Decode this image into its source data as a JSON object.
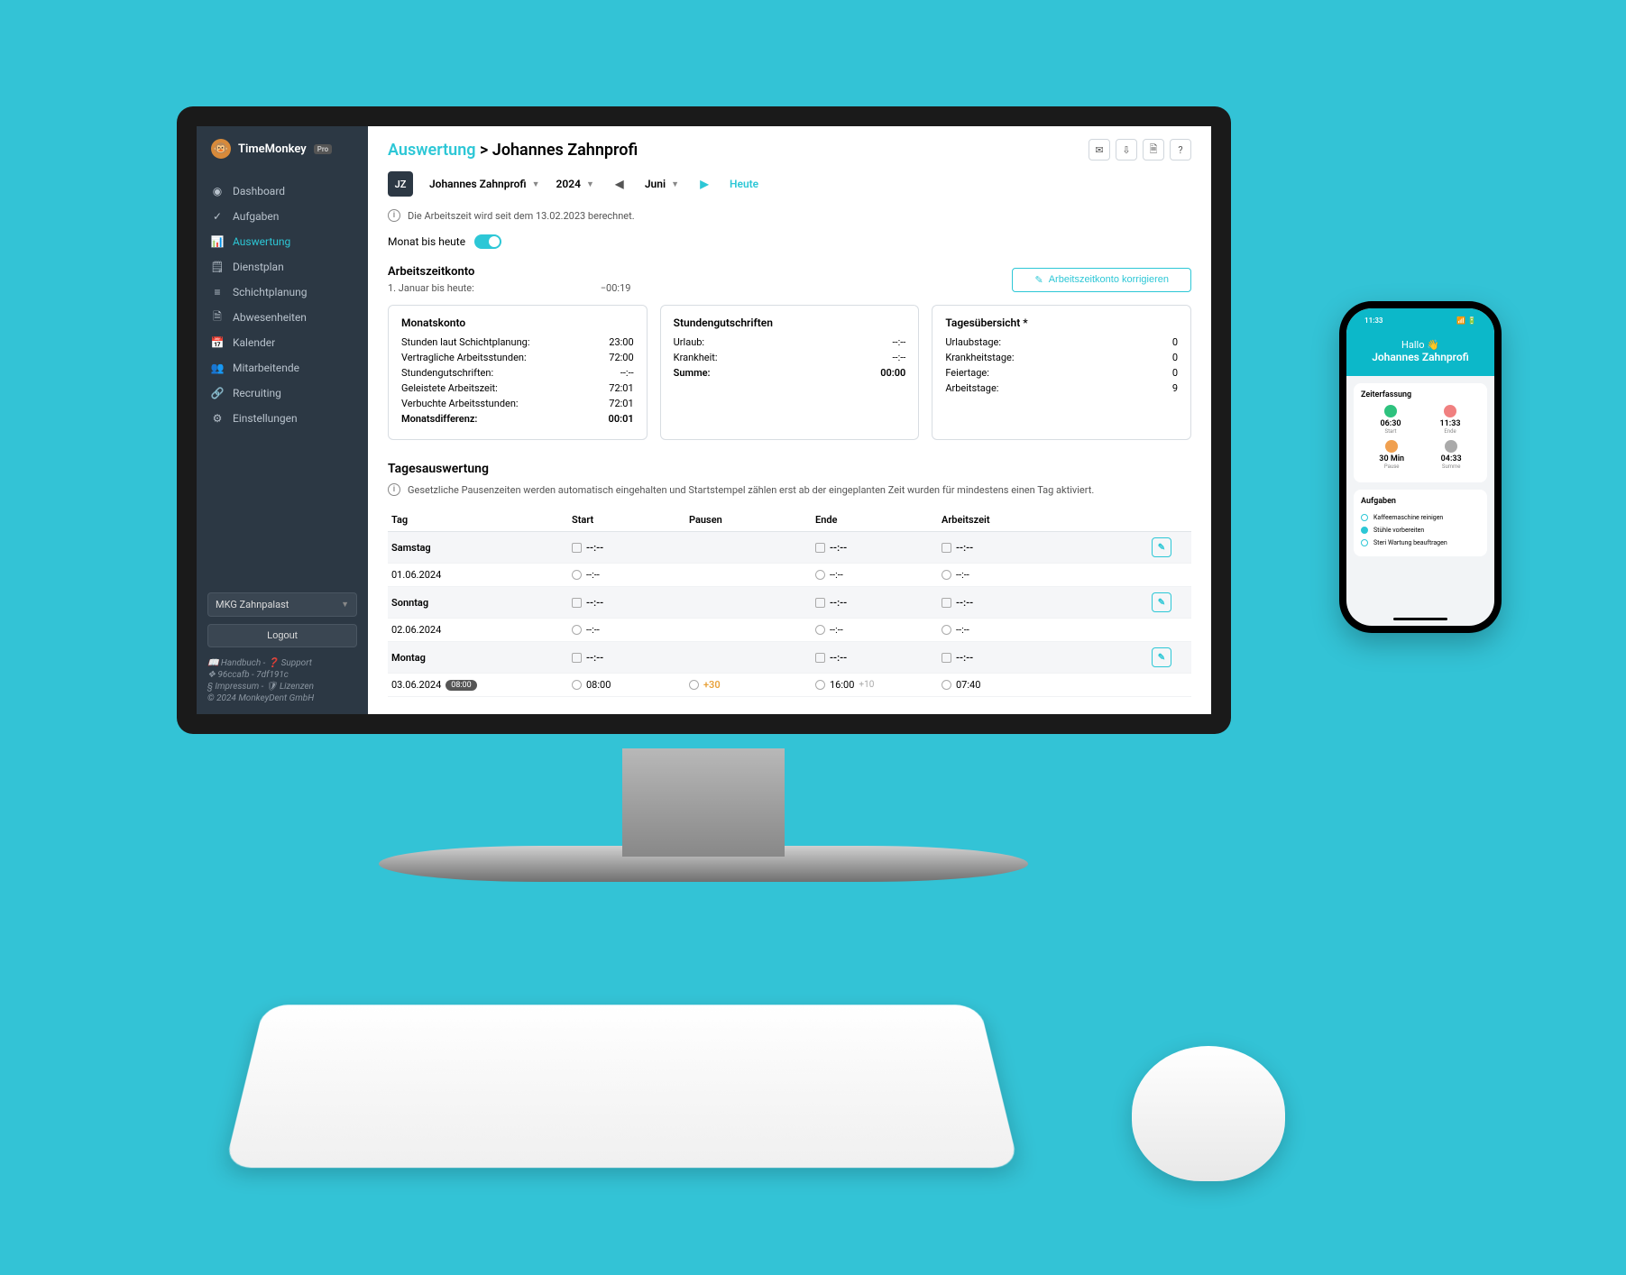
{
  "brand": {
    "name": "TimeMonkey",
    "badge": "Pro"
  },
  "sidebar": {
    "items": [
      {
        "label": "Dashboard",
        "icon": "gauge"
      },
      {
        "label": "Aufgaben",
        "icon": "check"
      },
      {
        "label": "Auswertung",
        "icon": "chart",
        "active": true
      },
      {
        "label": "Dienstplan",
        "icon": "clipboard"
      },
      {
        "label": "Schichtplanung",
        "icon": "layers"
      },
      {
        "label": "Abwesenheiten",
        "icon": "doc"
      },
      {
        "label": "Kalender",
        "icon": "calendar"
      },
      {
        "label": "Mitarbeitende",
        "icon": "people"
      },
      {
        "label": "Recruiting",
        "icon": "link"
      },
      {
        "label": "Einstellungen",
        "icon": "gear"
      }
    ],
    "org": "MKG Zahnpalast",
    "logout": "Logout",
    "footer": {
      "handbook": "Handbuch",
      "support": "Support",
      "build": "96ccafb - 7df191c",
      "impressum": "Impressum",
      "lizenzen": "Lizenzen",
      "copyright": "© 2024 MonkeyDent GmbH"
    }
  },
  "header": {
    "crumb_root": "Auswertung",
    "crumb_sep": ">",
    "crumb_leaf": "Johannes Zahnprofi"
  },
  "selector": {
    "avatar": "JZ",
    "name": "Johannes Zahnprofi",
    "year": "2024",
    "month": "Juni",
    "today": "Heute"
  },
  "info": "Die Arbeitszeit wird seit dem 13.02.2023 berechnet.",
  "toggle": {
    "label": "Monat bis heute",
    "on": true
  },
  "account": {
    "title": "Arbeitszeitkonto",
    "sub_label": "1. Januar bis heute:",
    "sub_value": "−00:19",
    "correct_label": "Arbeitszeitkonto korrigieren"
  },
  "cards": {
    "monatskonto": {
      "title": "Monatskonto",
      "rows": [
        {
          "k": "Stunden laut Schichtplanung:",
          "v": "23:00"
        },
        {
          "k": "Vertragliche Arbeitsstunden:",
          "v": "72:00"
        },
        {
          "k": "Stundengutschriften:",
          "v": "--:--"
        },
        {
          "k": "Geleistete Arbeitszeit:",
          "v": "72:01"
        },
        {
          "k": "Verbuchte Arbeitsstunden:",
          "v": "72:01"
        },
        {
          "k": "Monatsdifferenz:",
          "v": "00:01",
          "bold": true
        }
      ]
    },
    "gutschriften": {
      "title": "Stundengutschriften",
      "rows": [
        {
          "k": "Urlaub:",
          "v": "--:--"
        },
        {
          "k": "Krankheit:",
          "v": "--:--"
        },
        {
          "k": "Summe:",
          "v": "00:00",
          "bold": true
        }
      ]
    },
    "tagesuebersicht": {
      "title": "Tagesübersicht *",
      "rows": [
        {
          "k": "Urlaubstage:",
          "v": "0"
        },
        {
          "k": "Krankheitstage:",
          "v": "0"
        },
        {
          "k": "Feiertage:",
          "v": "0"
        },
        {
          "k": "Arbeitstage:",
          "v": "9"
        }
      ]
    }
  },
  "tages": {
    "title": "Tagesauswertung",
    "info": "Gesetzliche Pausenzeiten werden automatisch eingehalten und Startstempel zählen erst ab der eingeplanten Zeit wurden für mindestens einen Tag aktiviert.",
    "cols": {
      "tag": "Tag",
      "start": "Start",
      "pausen": "Pausen",
      "ende": "Ende",
      "arbeitszeit": "Arbeitszeit"
    },
    "groups": [
      {
        "day": "Samstag",
        "rows": [
          {
            "date": "01.06.2024",
            "start": "--:--",
            "pause": "",
            "ende": "--:--",
            "az": "--:--",
            "header_start": "--:--",
            "header_ende": "--:--",
            "header_az": "--:--"
          }
        ]
      },
      {
        "day": "Sonntag",
        "rows": [
          {
            "date": "02.06.2024",
            "start": "--:--",
            "pause": "",
            "ende": "--:--",
            "az": "--:--",
            "header_start": "--:--",
            "header_ende": "--:--",
            "header_az": "--:--"
          }
        ]
      },
      {
        "day": "Montag",
        "rows": [
          {
            "date": "03.06.2024",
            "badge": "08:00",
            "start": "08:00",
            "pause": "+30",
            "ende": "16:00",
            "ende_plus": "+10",
            "az": "07:40",
            "header_start": "--:--",
            "header_ende": "--:--",
            "header_az": "--:--"
          }
        ]
      }
    ]
  },
  "phone": {
    "time": "11:33",
    "hello": "Hallo 👋",
    "name": "Johannes Zahnprofi",
    "card1_title": "Zeiterfassung",
    "times": [
      {
        "color": "green",
        "t": "06:30",
        "lbl": "Start"
      },
      {
        "color": "red",
        "t": "11:33",
        "lbl": "Ende"
      },
      {
        "color": "orange",
        "t": "30 Min",
        "lbl": "Pause"
      },
      {
        "color": "grey",
        "t": "04:33",
        "lbl": "Summe"
      }
    ],
    "card2_title": "Aufgaben",
    "tasks": [
      {
        "label": "Kaffeemaschine reinigen",
        "done": false
      },
      {
        "label": "Stühle vorbereiten",
        "done": true
      },
      {
        "label": "Steri Wartung beauftragen",
        "done": false
      }
    ]
  }
}
